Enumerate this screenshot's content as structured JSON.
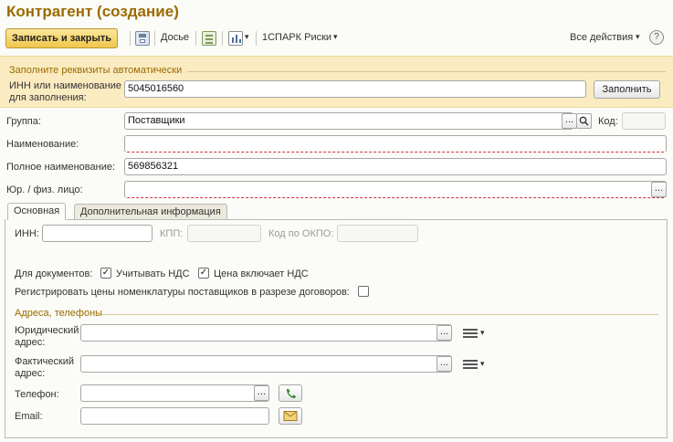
{
  "window": {
    "title": "Контрагент (создание)"
  },
  "toolbar": {
    "save_close_label": "Записать и закрыть",
    "dossier_label": "Досье",
    "spark_label": "1СПАРК Риски",
    "all_actions_label": "Все действия",
    "help_label": "?"
  },
  "autofill": {
    "title": "Заполните реквизиты автоматически",
    "inn_label_line1": "ИНН или наименование",
    "inn_label_line2": "для заполнения:",
    "inn_value": "5045016560",
    "fill_button": "Заполнить"
  },
  "form": {
    "group_label": "Группа:",
    "group_value": "Поставщики",
    "code_label": "Код:",
    "code_value": "",
    "name_label": "Наименование:",
    "name_value": "",
    "full_name_label": "Полное наименование:",
    "full_name_value": "569856321",
    "entity_type_label": "Юр. / физ. лицо:",
    "entity_type_value": ""
  },
  "tabs": [
    {
      "label": "Основная",
      "active": true
    },
    {
      "label": "Дополнительная информация",
      "active": false
    }
  ],
  "main_tab": {
    "inn_label": "ИНН:",
    "inn_value": "",
    "kpp_label": "КПП:",
    "kpp_value": "",
    "okpo_label": "Код по ОКПО:",
    "okpo_value": "",
    "for_docs_label": "Для документов:",
    "vat_account_label": "Учитывать НДС",
    "vat_account_checked": true,
    "price_incl_vat_label": "Цена включает НДС",
    "price_incl_vat_checked": true,
    "register_prices_label": "Регистрировать цены номенклатуры поставщиков в разрезе договоров:",
    "register_prices_checked": false,
    "addresses_title": "Адреса, телефоны",
    "legal_address_label_1": "Юридический",
    "legal_address_label_2": "адрес:",
    "legal_address_value": "",
    "actual_address_label_1": "Фактический",
    "actual_address_label_2": "адрес:",
    "actual_address_value": "",
    "phone_label": "Телефон:",
    "phone_value": "",
    "email_label": "Email:",
    "email_value": ""
  },
  "glyphs": {
    "ellipsis": "...",
    "checkmark": "✓",
    "dropdown": "▾"
  },
  "colors": {
    "title": "#9a6b00",
    "panel_bg": "#fbebc1",
    "main_button": "#f0c54a"
  }
}
